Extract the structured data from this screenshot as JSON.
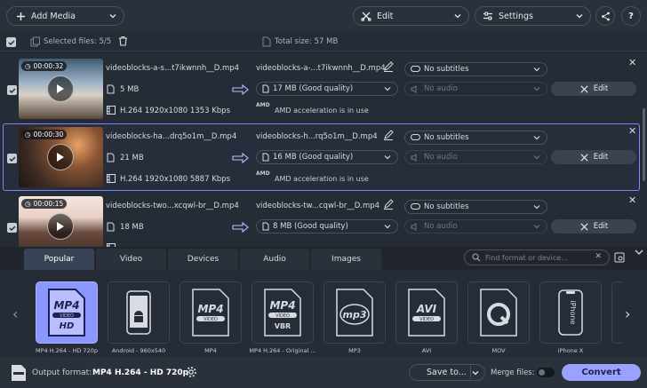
{
  "toolbar": {
    "add_media": "Add Media",
    "edit": "Edit",
    "settings": "Settings"
  },
  "selection": {
    "selected_files": "Selected files: 5/5",
    "total_size": "Total size: 57 MB"
  },
  "files": [
    {
      "duration": "00:00:32",
      "source_name": "videoblocks-a-s...t7ikwnnh__D.mp4",
      "source_size": "5 MB",
      "source_info": "H.264 1920x1080 1353 Kbps",
      "output_name": "videoblocks-a-...t7ikwnnh__D.mp4",
      "output_size": "17 MB (Good quality)",
      "acceleration": "AMD acceleration is in use",
      "subtitles": "No subtitles",
      "audio": "No audio",
      "edit_label": "Edit",
      "selected": false
    },
    {
      "duration": "00:00:30",
      "source_name": "videoblocks-ha...drq5o1m__D.mp4",
      "source_size": "21 MB",
      "source_info": "H.264 1920x1080 5887 Kbps",
      "output_name": "videoblocks-h...rq5o1m__D.mp4",
      "output_size": "16 MB (Good quality)",
      "acceleration": "AMD acceleration is in use",
      "subtitles": "No subtitles",
      "audio": "No audio",
      "edit_label": "Edit",
      "selected": true
    },
    {
      "duration": "00:00:15",
      "source_name": "videoblocks-two...xcqwl-br__D.mp4",
      "source_size": "18 MB",
      "source_info": "",
      "output_name": "videoblocks-tw...cqwl-br__D.mp4",
      "output_size": "8 MB (Good quality)",
      "acceleration": "",
      "subtitles": "No subtitles",
      "audio": "No audio",
      "edit_label": "Edit",
      "selected": false
    }
  ],
  "format_tabs": [
    "Popular",
    "Video",
    "Devices",
    "Audio",
    "Images"
  ],
  "search": {
    "placeholder": "Find format or device..."
  },
  "presets": [
    {
      "label": "MP4 H.264 - HD 720p",
      "icon": "mp4-hd-icon",
      "active": true
    },
    {
      "label": "Android - 960x540",
      "icon": "android-icon",
      "active": false
    },
    {
      "label": "MP4",
      "icon": "mp4-icon",
      "active": false
    },
    {
      "label": "MP4 H.264 - Original ...",
      "icon": "mp4-vbr-icon",
      "active": false
    },
    {
      "label": "MP3",
      "icon": "mp3-icon",
      "active": false
    },
    {
      "label": "AVI",
      "icon": "avi-icon",
      "active": false
    },
    {
      "label": "MOV",
      "icon": "mov-icon",
      "active": false
    },
    {
      "label": "iPhone X",
      "icon": "iphone-icon",
      "active": false
    }
  ],
  "preset_text": {
    "mp4": "MP4",
    "hd": "HD",
    "video": "VIDEO",
    "vbr": "VBR",
    "mp3": "mp3",
    "avi": "AVI",
    "iphone": "iPhone"
  },
  "bottom": {
    "output_format_label": "Output format:",
    "output_format_value": "MP4 H.264 - HD 720p",
    "save_to": "Save to...",
    "merge_files": "Merge files:",
    "convert": "Convert"
  },
  "colors": {
    "accent": "#9aa2ff",
    "selected_border": "#7d86ff",
    "background": "#262c36"
  }
}
